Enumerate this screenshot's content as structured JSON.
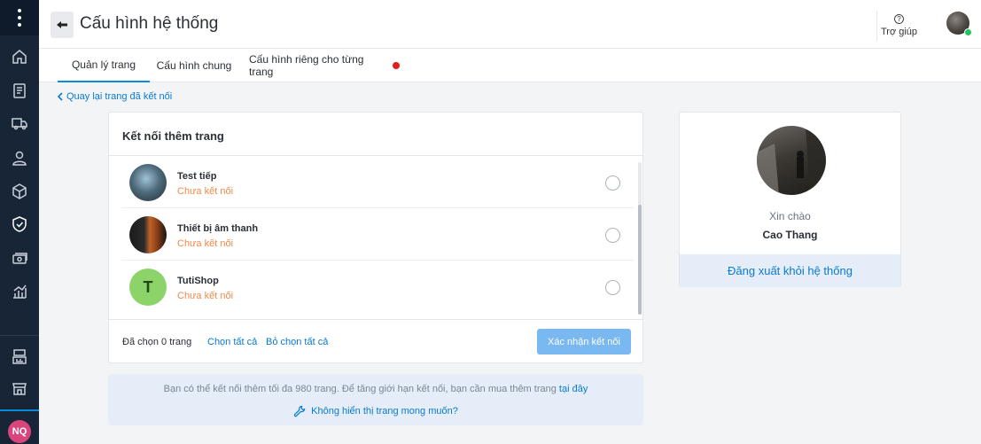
{
  "header": {
    "title": "Cấu hình hệ thống",
    "help_label": "Trợ giúp"
  },
  "tabs": [
    {
      "label": "Quản lý trang",
      "active": true
    },
    {
      "label": "Cấu hình chung",
      "active": false
    },
    {
      "label": "Cấu hình riêng cho từng trang",
      "active": false,
      "has_alert_dot": true
    }
  ],
  "back_link": "Quay lại trang đã kết nối",
  "connect_card": {
    "title": "Kết nối thêm trang",
    "pages": [
      {
        "name": "Test tiếp",
        "status": "Chưa kết nối",
        "selected": false
      },
      {
        "name": "Thiết bị âm thanh",
        "status": "Chưa kết nối",
        "selected": false
      },
      {
        "name": "TutiShop",
        "status": "Chưa kết nối",
        "selected": false,
        "avatar_letter": "T"
      }
    ],
    "selected_count": "Đã chọn 0 trang",
    "select_all": "Chọn tất cả",
    "deselect_all": "Bỏ chọn tất cả",
    "confirm_button": "Xác nhận kết nối"
  },
  "info": {
    "text": "Bạn có thể kết nối thêm tối đa 980 trang. Để tăng giới hạn kết nối, bạn cần mua thêm trang",
    "link": "tại đây",
    "help": "Không hiển thị trang mong muốn?"
  },
  "profile": {
    "greeting": "Xin chào",
    "name": "Cao Thang",
    "logout": "Đăng xuất khỏi hệ thống"
  },
  "sidebar": {
    "user_initials": "NQ",
    "icons": [
      "home-icon",
      "order-icon",
      "shipping-icon",
      "customer-icon",
      "product-icon",
      "shield-icon",
      "cash-icon",
      "report-icon",
      "pos-icon",
      "store-icon"
    ]
  },
  "colors": {
    "sidebar_bg": "#182537",
    "accent": "#0a8ad8",
    "status_orange": "#f28a4a",
    "confirm_button": "#79b8f0",
    "alert_dot": "#e11d1d"
  }
}
